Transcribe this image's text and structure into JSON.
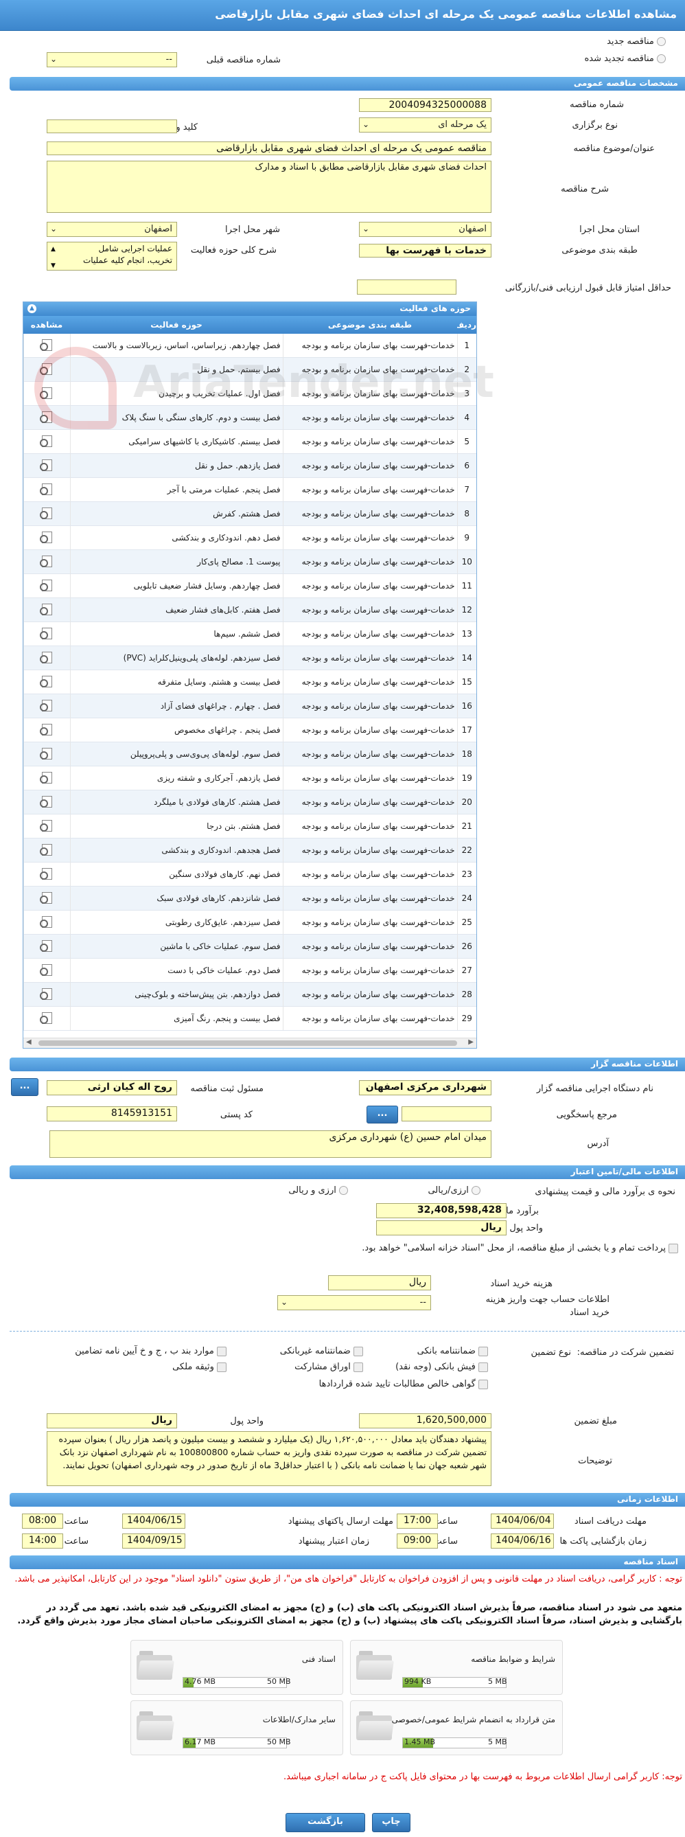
{
  "page_title": "مشاهده اطلاعات مناقصه عمومی یک مرحله ای احداث فضای شهری مقابل بازارقاضی",
  "top": {
    "new_tender": "مناقصه جدید",
    "renewed_tender": "مناقصه تجدید شده",
    "prev_number_label": "شماره مناقصه قبلی",
    "prev_number_value": "--"
  },
  "general": {
    "section_title": "مشخصات مناقصه عمومی",
    "number_label": "شماره مناقصه",
    "number_value": "2004094325000088",
    "type_label": "نوع برگزاری",
    "type_value": "یک مرحله ای",
    "keyword_label": "کلید واژه",
    "keyword_value": "",
    "subject_label": "عنوان/موضوع مناقصه",
    "subject_value": "مناقصه عمومی یک مرحله ای احداث فضای شهری مقابل بازارقاضی",
    "desc_label": "شرح مناقصه",
    "desc_value": "احداث فضای شهری مقابل بازارقاضی مطابق با اسناد و مدارک",
    "province_label": "استان محل اجرا",
    "province_value": "اصفهان",
    "city_label": "شهر محل اجرا",
    "city_value": "اصفهان",
    "category_label": "طبقه بندی موضوعی",
    "category_value": "خدمات با فهرست بها",
    "scope_label": "شرح کلی حوزه فعالیت",
    "scope_value_1": "عملیات اجرایی شامل",
    "scope_value_2": "تخریب، انجام کلیه عملیات",
    "min_score_label": "حداقل امتیاز قابل قبول ارزیابی فنی/بازرگانی",
    "min_score_value": ""
  },
  "activities": {
    "title": "حوزه های فعالیت",
    "headers": {
      "row": "ردیف",
      "category": "طبقه بندی موضوعی",
      "activity": "حوزه فعالیت",
      "view": "مشاهده"
    },
    "category_text": "خدمات-فهرست بهای سازمان برنامه و بودجه",
    "rows": [
      {
        "n": "1",
        "a": "فصل چهاردهم. زیراساس، اساس، زیربالاست و بالاست"
      },
      {
        "n": "2",
        "a": "فصل بیستم. حمل و نقل"
      },
      {
        "n": "3",
        "a": "فصل اول. عملیات تخریب و برچیدن"
      },
      {
        "n": "4",
        "a": "فصل بیست و دوم. کارهای سنگی با سنگ پلاک"
      },
      {
        "n": "5",
        "a": "فصل بیستم. کاشیکاری با کاشیهای سرامیکی"
      },
      {
        "n": "6",
        "a": "فصل یازدهم. حمل و نقل"
      },
      {
        "n": "7",
        "a": "فصل پنجم. عملیات مرمتی با آجر"
      },
      {
        "n": "8",
        "a": "فصل هشتم. کفرش"
      },
      {
        "n": "9",
        "a": "فصل دهم. اندودکاری و بندکشی"
      },
      {
        "n": "10",
        "a": "پیوست 1. مصالح پای‌کار"
      },
      {
        "n": "11",
        "a": "فصل چهاردهم. وسایل فشار ضعیف تابلویی"
      },
      {
        "n": "12",
        "a": "فصل هفتم. کابل‌های فشار ضعیف"
      },
      {
        "n": "13",
        "a": "فصل ششم. سیم‌ها"
      },
      {
        "n": "14",
        "a": "فصل سیزدهم. لوله‌های پلی‌وینیل‌کلراید (PVC)"
      },
      {
        "n": "15",
        "a": "فصل بیست و هشتم. وسایل متفرقه"
      },
      {
        "n": "16",
        "a": "فصل . چهارم . چراغهای فضای آزاد"
      },
      {
        "n": "17",
        "a": "فصل پنجم . چراغهای مخصوص"
      },
      {
        "n": "18",
        "a": "فصل سوم. لوله‌های پی‌وی‌سی و پلی‌پروپیلن"
      },
      {
        "n": "19",
        "a": "فصل یازدهم. آجرکاری و شفته ریزی"
      },
      {
        "n": "20",
        "a": "فصل هشتم. کارهای فولادی با میلگرد"
      },
      {
        "n": "21",
        "a": "فصل هشتم. بتن درجا"
      },
      {
        "n": "22",
        "a": "فصل هجدهم. اندودکاری و بندکشی"
      },
      {
        "n": "23",
        "a": "فصل نهم. کارهای فولادی سنگین"
      },
      {
        "n": "24",
        "a": "فصل شانزدهم. کارهای فولادی سبک"
      },
      {
        "n": "25",
        "a": "فصل سیزدهم. عایق‌کاری رطوبتی"
      },
      {
        "n": "26",
        "a": "فصل سوم. عملیات خاکی با ماشین"
      },
      {
        "n": "27",
        "a": "فصل دوم. عملیات خاکی با دست"
      },
      {
        "n": "28",
        "a": "فصل دوازدهم. بتن پیش‌ساخته و بلوک‌چینی"
      },
      {
        "n": "29",
        "a": "فصل بیست و پنجم. رنگ آمیزی"
      }
    ]
  },
  "organizer": {
    "section_title": "اطلاعات مناقصه گزار",
    "org_label": "نام دستگاه اجرایی مناقصه گزار",
    "org_value": "شهرداری مرکزی اصفهان",
    "responsible_label": "مسئول ثبت مناقصه",
    "responsible_value": "روح اله کیان ارثی",
    "ref_label": "مرجع پاسخگویی",
    "ref_value": "",
    "postal_label": "کد پستی",
    "postal_value": "8145913151",
    "address_label": "آدرس",
    "address_value": "میدان امام حسین (ع) شهرداری مرکزی",
    "dots": "..."
  },
  "finance": {
    "section_title": "اطلاعات مالی/تامین اعتبار",
    "method_label": "نحوه ی برآورد مالی و قیمت پیشنهادی",
    "method_rial": "ارزی/ریالی",
    "method_both": "ارزی و ریالی",
    "estimate_label": "برآورد مالی",
    "estimate_value": "32,408,598,428",
    "unit_label": "واحد پول",
    "unit_value": "ریال",
    "treasury_text": "پرداخت تمام و یا بخشی از مبلغ مناقصه، از محل \"اسناد خزانه اسلامی\" خواهد بود.",
    "doc_cost_label": "هزینه خرید اسناد",
    "doc_cost_value": "ریال",
    "account_label_1": "اطلاعات حساب جهت واریز هزینه",
    "account_label_2": "خرید اسناد",
    "account_value": "--"
  },
  "guarantee": {
    "type_label": "تضمین شرکت در مناقصه:",
    "kind_label": "نوع تضمین",
    "o1": "ضمانتنامه بانکی",
    "o2": "ضمانتنامه غیربانکی",
    "o3": "موارد بند ب ، ج و خ آیین نامه تضامین",
    "o4": "فیش بانکی (وجه نقد)",
    "o5": "اوراق مشارکت",
    "o6": "وثیقه ملکی",
    "o7": "گواهی خالص مطالبات تایید شده قراردادها",
    "amount_label": "مبلغ تضمین",
    "amount_value": "1,620,500,000",
    "unit_label": "واحد پول",
    "unit_value": "ریال",
    "desc_label": "توضیحات",
    "desc_value": "پیشنهاد دهندگان باید معادل ۱,۶۲۰,۵۰۰,۰۰۰ ریال (یک میلیارد و ششصد و بیست میلیون و پانصد هزار ریال ) بعنوان سپرده تضمین شرکت در مناقصه به صورت سپرده نقدی واریز به حساب شماره 100800800 به نام شهرداری اصفهان نزد بانک شهر شعبه جهان نما یا ضمانت نامه بانکی ( با اعتبار حداقل3 ماه از تاریخ صدور در وجه شهرداری اصفهان) تحویل نمایند."
  },
  "timing": {
    "section_title": "اطلاعات زمانی",
    "doc_deadline_label": "مهلت دریافت اسناد",
    "doc_deadline_date": "1404/06/04",
    "doc_deadline_time": "17:00",
    "send_deadline_label": "مهلت ارسال پاکتهای پیشنهاد",
    "send_deadline_date": "1404/06/15",
    "send_deadline_time": "08:00",
    "open_label": "زمان بازگشایی پاکت ها",
    "open_date": "1404/06/16",
    "open_time": "09:00",
    "validity_label": "زمان اعتبار پیشنهاد",
    "validity_date": "1404/09/15",
    "validity_time": "14:00",
    "time_label": "ساعت"
  },
  "documents": {
    "section_title": "اسناد مناقصه",
    "note1": "توجه : کاربر گرامی، دریافت اسناد در مهلت قانونی و پس از افزودن فراخوان به کارتابل \"فراخوان های من\"، از طریق ستون \"دانلود اسناد\" موجود در این کارتابل، امکانپذیر می باشد.",
    "note2": "متعهد می شود در اسناد مناقصه، صرفاً بذیرش اسناد الکترونیکی پاکت های (ب) و (ج) مجهز به امضای الکترونیکی قید شده باشد. تعهد می گردد در بارگشایی و بذیرش اسناد، صرفاً اسناد الکترونیکی پاکت های پیشنهاد (ب) و (ج) مجهز به امضای الکترونیکی صاحبان امضای مجاز مورد بذیرش واقع گردد.",
    "files": [
      {
        "name": "شرایط و ضوابط مناقصه",
        "size": "994 KB",
        "max": "5 MB",
        "fill": 0.19
      },
      {
        "name": "اسناد فنی",
        "size": "4.76 MB",
        "max": "50 MB",
        "fill": 0.1
      },
      {
        "name": "متن قرارداد به انضمام شرایط عمومی/خصوصی",
        "size": "1.45 MB",
        "max": "5 MB",
        "fill": 0.29
      },
      {
        "name": "سایر مدارک/اطلاعات",
        "size": "6.17 MB",
        "max": "50 MB",
        "fill": 0.12
      }
    ],
    "note3": "توجه: کاربر گرامی ارسال اطلاعات مربوط به فهرست بها در محتوای فایل پاکت ج در سامانه اجباری میباشد."
  },
  "buttons": {
    "print": "چاپ",
    "back": "بازگشت"
  },
  "watermark": "AriaTender.net"
}
